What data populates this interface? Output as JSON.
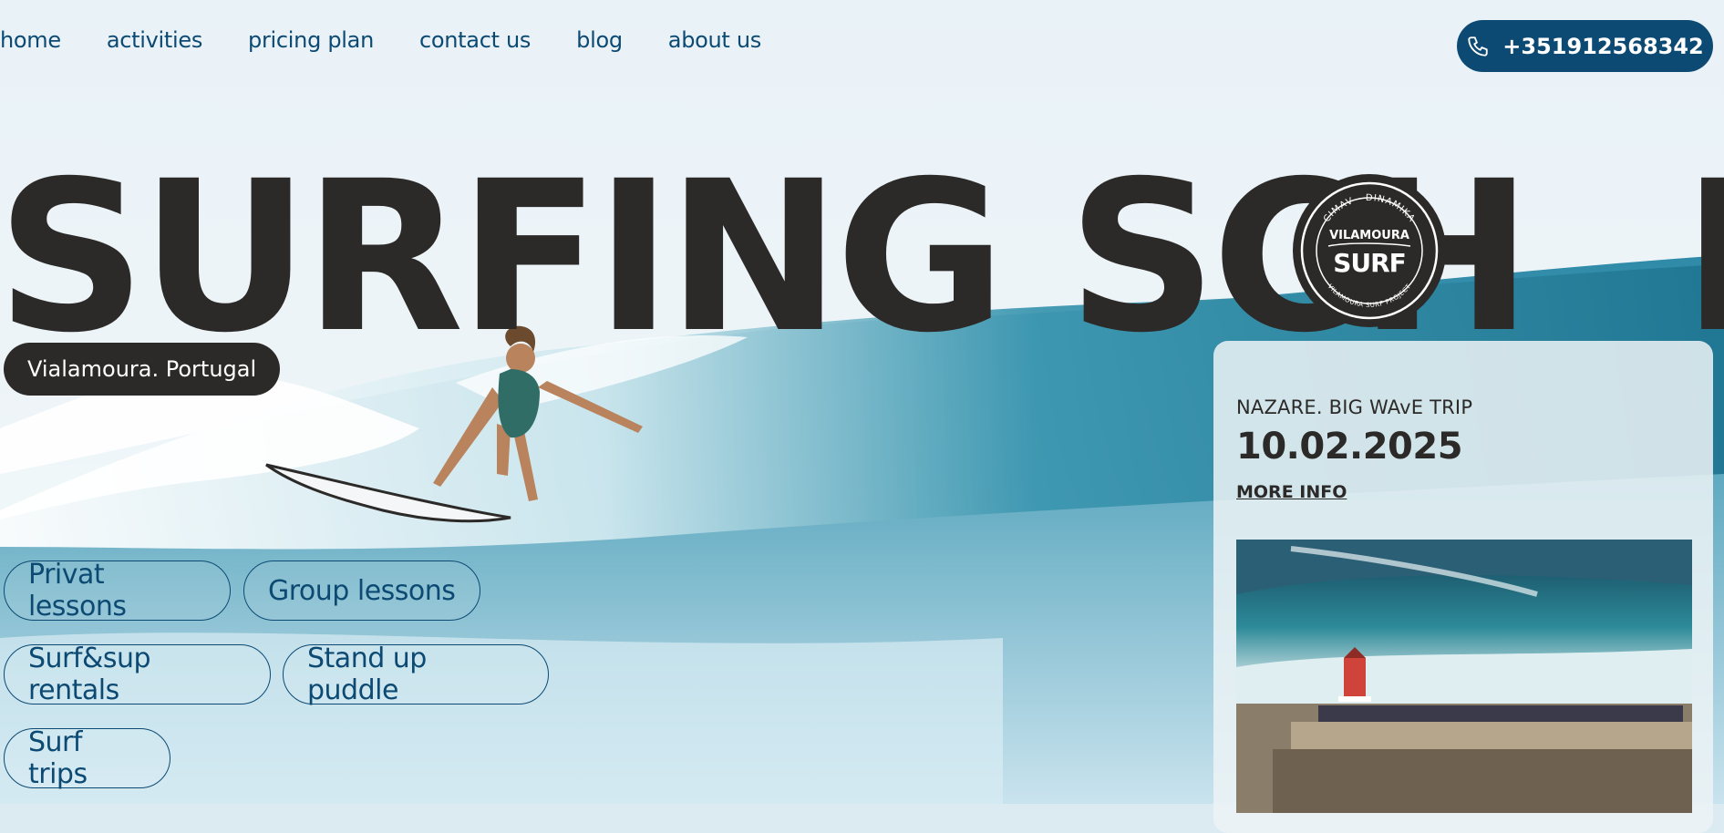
{
  "nav": {
    "items": [
      "home",
      "activities",
      "pricing plan",
      "contact us",
      "blog",
      "about us"
    ]
  },
  "phone": {
    "label": "+351912568342",
    "icon": "phone-icon"
  },
  "hero": {
    "title_left": "SURFING SCH",
    "title_right": "L",
    "location": "Vialamoura. Portugal"
  },
  "logo": {
    "top_text": "CIMAV - DINAMIKA",
    "name": "VILAMOURA",
    "mark": "SURF",
    "bottom_text": "VILAMOURA SURF PROJECT"
  },
  "services": [
    "Privat lessons",
    "Group lessons",
    "Surf&sup rentals",
    "Stand up puddle",
    "Surf trips"
  ],
  "event": {
    "eyebrow": "NAZARE. BIG WAvE TRIP",
    "date": "10.02.2025",
    "link": "MORE INFO"
  },
  "colors": {
    "brand_blue": "#0c4a73",
    "dark": "#2c2a28",
    "sky": "#e7f1f6",
    "sea": "#3f93b0"
  }
}
